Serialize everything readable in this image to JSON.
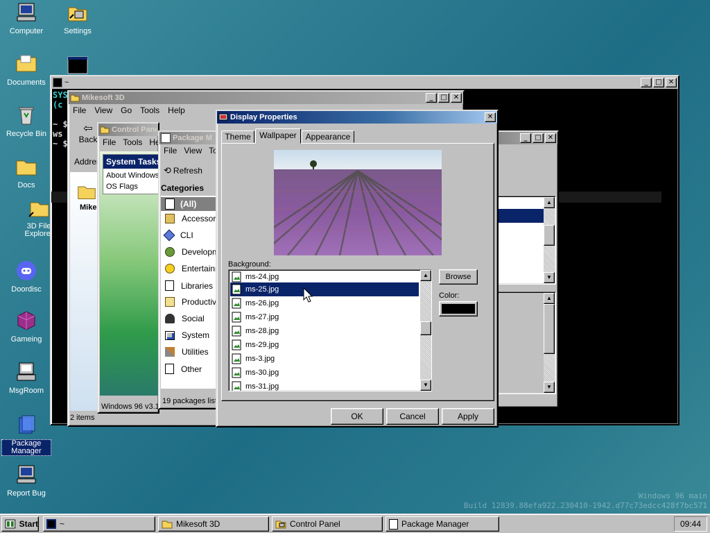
{
  "desktop": {
    "icons": [
      {
        "label": "Computer"
      },
      {
        "label": "Settings"
      },
      {
        "label": "Documents"
      },
      {
        "label": "Recycle Bin"
      },
      {
        "label": "Docs"
      },
      {
        "label": "3D File Explorer"
      },
      {
        "label": "Doordisc"
      },
      {
        "label": "Gameing"
      },
      {
        "label": "MsgRoom"
      },
      {
        "label": "Package Manager"
      },
      {
        "label": "Report Bug"
      }
    ],
    "watermark_line1": "Windows 96 main",
    "watermark_line2": "Build 12839.88efa922.230410-1942.d77c73edcc428f7bc571"
  },
  "terminal": {
    "title": "~",
    "lines": [
      "SYS",
      "(c",
      "",
      "~ $",
      "ws",
      "~ $"
    ]
  },
  "mikesoft": {
    "title": "Mikesoft 3D",
    "menu": [
      "File",
      "View",
      "Go",
      "Tools",
      "Help"
    ],
    "back_label": "Back",
    "address_label": "Addres",
    "folder_label": "Mike",
    "status": "2 items"
  },
  "control_panel": {
    "title": "Control Panel",
    "menu": [
      "File",
      "Tools",
      "Hel"
    ],
    "tasks_header": "System Tasks",
    "tasks": [
      "About Windows",
      "OS Flags"
    ],
    "status": "Windows 96 v3.1"
  },
  "package_manager": {
    "title": "Package M",
    "menu": [
      "File",
      "View",
      "To"
    ],
    "refresh_label": "Refresh",
    "categories_header": "Categories",
    "categories": [
      "(All)",
      "Accessori",
      "CLI",
      "Developm",
      "Entertainm",
      "Libraries",
      "Productivi",
      "Social",
      "System",
      "Utilities",
      "Other"
    ],
    "status": "19 packages liste"
  },
  "display_properties": {
    "title": "Display Properties",
    "tabs": [
      "Theme",
      "Wallpaper",
      "Appearance"
    ],
    "active_tab": "Wallpaper",
    "background_label": "Background:",
    "files": [
      "ms-24.jpg",
      "ms-25.jpg",
      "ms-26.jpg",
      "ms-27.jpg",
      "ms-28.jpg",
      "ms-29.jpg",
      "ms-3.jpg",
      "ms-30.jpg",
      "ms-31.jpg"
    ],
    "selected_file": "ms-25.jpg",
    "browse_label": "Browse",
    "color_label": "Color:",
    "color_value": "#000000",
    "ok_label": "OK",
    "cancel_label": "Cancel",
    "apply_label": "Apply"
  },
  "taskbar": {
    "start_label": "Start",
    "tasks": [
      "~",
      "Mikesoft 3D",
      "Control Panel",
      "Package Manager"
    ],
    "clock": "09:44"
  },
  "colors": {
    "title_active": "#0a246a",
    "selection": "#0a246a",
    "face": "#c0c0c0"
  }
}
